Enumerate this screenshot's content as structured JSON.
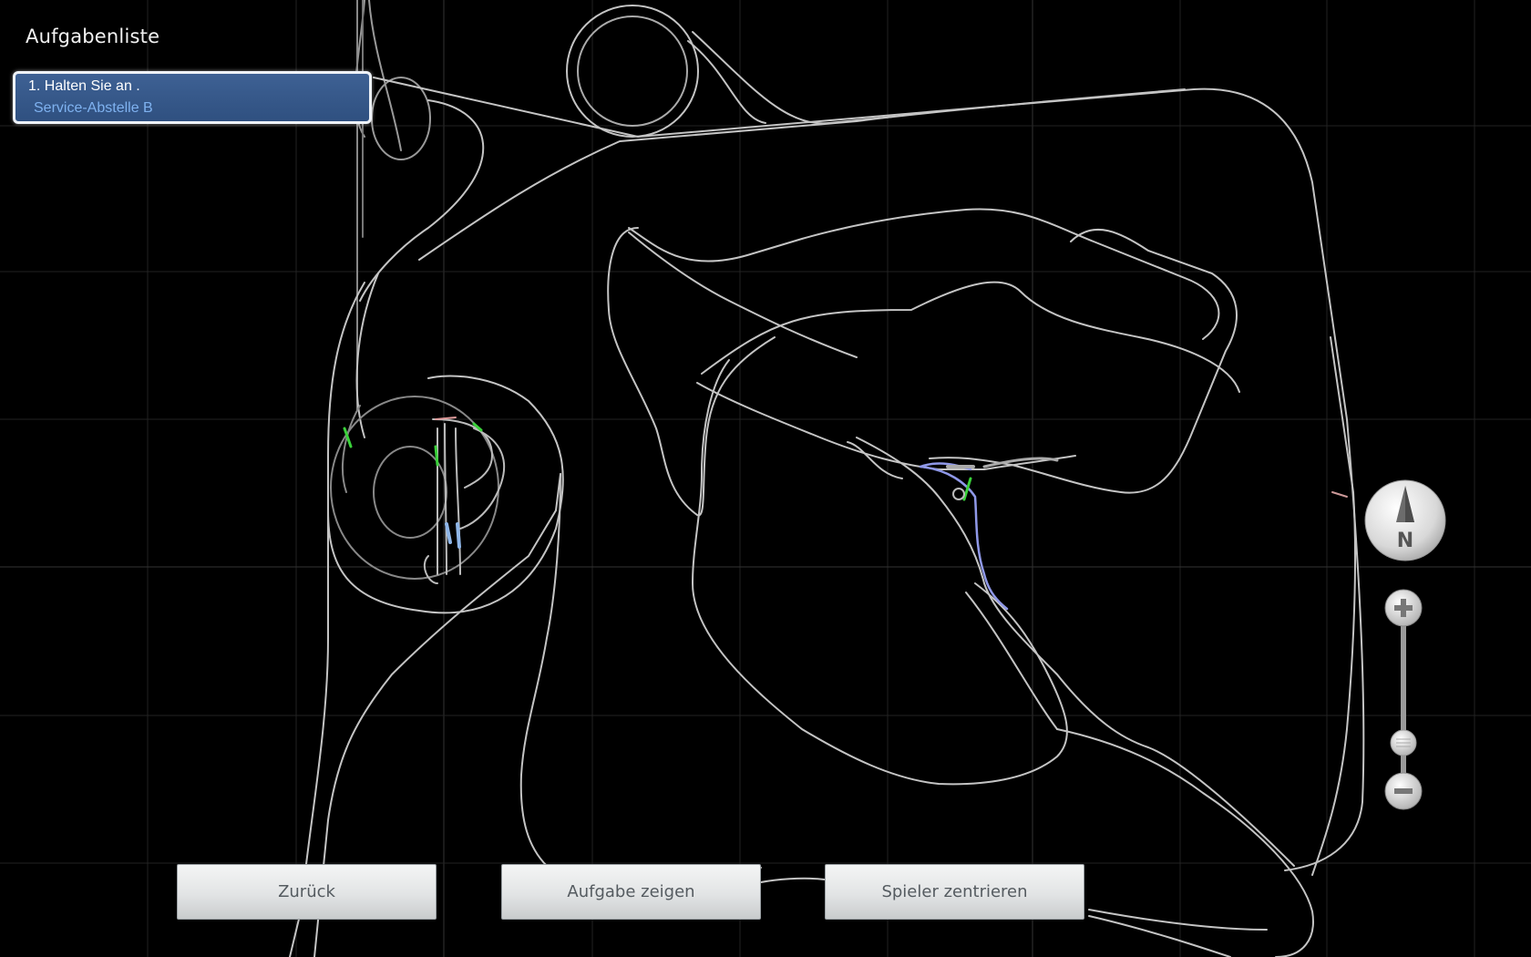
{
  "panel": {
    "title": "Aufgabenliste",
    "task_line1": "1. Halten Sie an  .",
    "task_line2": "Service-Abstelle B"
  },
  "buttons": {
    "back": "Zurück",
    "show_task": "Aufgabe zeigen",
    "center_player": "Spieler zentrieren"
  },
  "compass": {
    "label": "N"
  },
  "colors": {
    "track": "#c8c8c8",
    "track_dim": "#8a8a8a",
    "grid": "#262626",
    "route": "#8f98e8",
    "signal_green": "#3ad13a",
    "task_card": "#3e6194",
    "task_sub": "#7fb2f0"
  },
  "icons": [
    "compass-icon",
    "zoom-in-icon",
    "zoom-out-icon",
    "zoom-slider-thumb"
  ]
}
